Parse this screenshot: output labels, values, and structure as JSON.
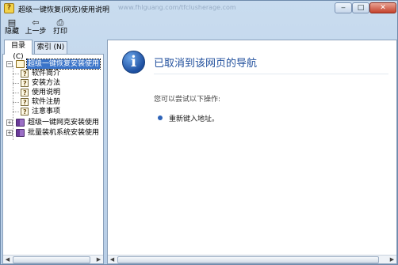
{
  "window": {
    "title": "超级一键恢复(网克)使用说明",
    "title_ghost": "www.fhlguang.com/tfclusherage.com",
    "minimize_glyph": "‒",
    "maximize_glyph": "□",
    "close_glyph": "✕"
  },
  "toolbar": {
    "hide_label": "隐藏",
    "back_label": "上一步",
    "print_label": "打印",
    "hide_icon": "hide-pane-icon",
    "back_icon": "back-arrow-icon",
    "print_icon": "printer-icon"
  },
  "tabs": {
    "contents": "目录 (C)",
    "index": "索引 (N)"
  },
  "tree": {
    "root1": "超级一键恢复安装使用",
    "children": [
      "软件简介",
      "安装方法",
      "使用说明",
      "软件注册",
      "注意事项"
    ],
    "root2": "超级一键网克安装使用",
    "root3": "批量装机系统安装使用",
    "expanded_glyph": "−",
    "collapsed_glyph": "+"
  },
  "content": {
    "heading": "已取消到该网页的导航",
    "subtext": "您可以尝试以下操作:",
    "option": "重新键入地址。",
    "info_glyph": "i"
  },
  "colors": {
    "frame": "#c9dcef",
    "heading": "#1f4e9c",
    "selection": "#3a74c9"
  }
}
